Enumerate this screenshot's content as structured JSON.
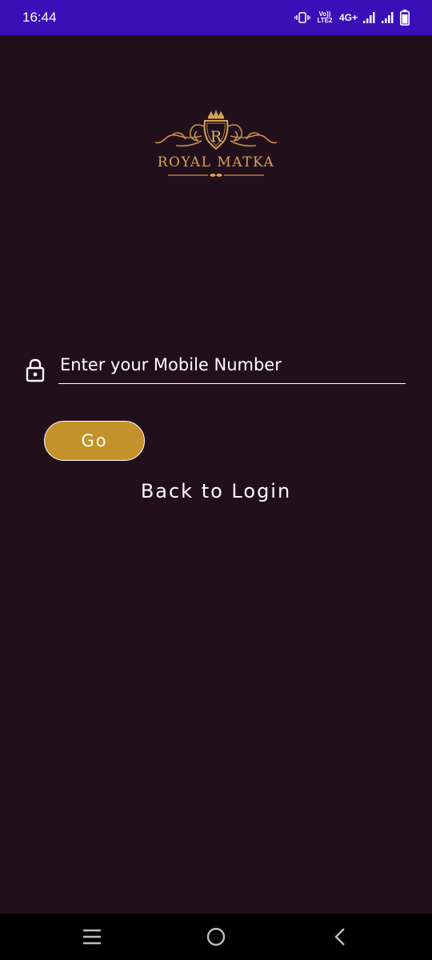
{
  "status_bar": {
    "time": "16:44",
    "volte_label": "Vo)) LTE2",
    "network_label": "4G+",
    "icons": [
      "vibrate-icon",
      "signal-icon",
      "signal-icon",
      "battery-icon"
    ]
  },
  "logo": {
    "letter": "R",
    "brand_name": "ROYAL MATKA"
  },
  "form": {
    "mobile_placeholder": "Enter your Mobile Number",
    "mobile_value": "",
    "go_label": "Go",
    "back_label": "Back to Login"
  },
  "nav_bar": {
    "icons": [
      "recent-apps-icon",
      "home-icon",
      "back-icon"
    ]
  },
  "colors": {
    "background": "#21101c",
    "status_bar": "#3a0fb8",
    "accent_gold": "#c4922a",
    "logo_gold": "#d8a257"
  }
}
